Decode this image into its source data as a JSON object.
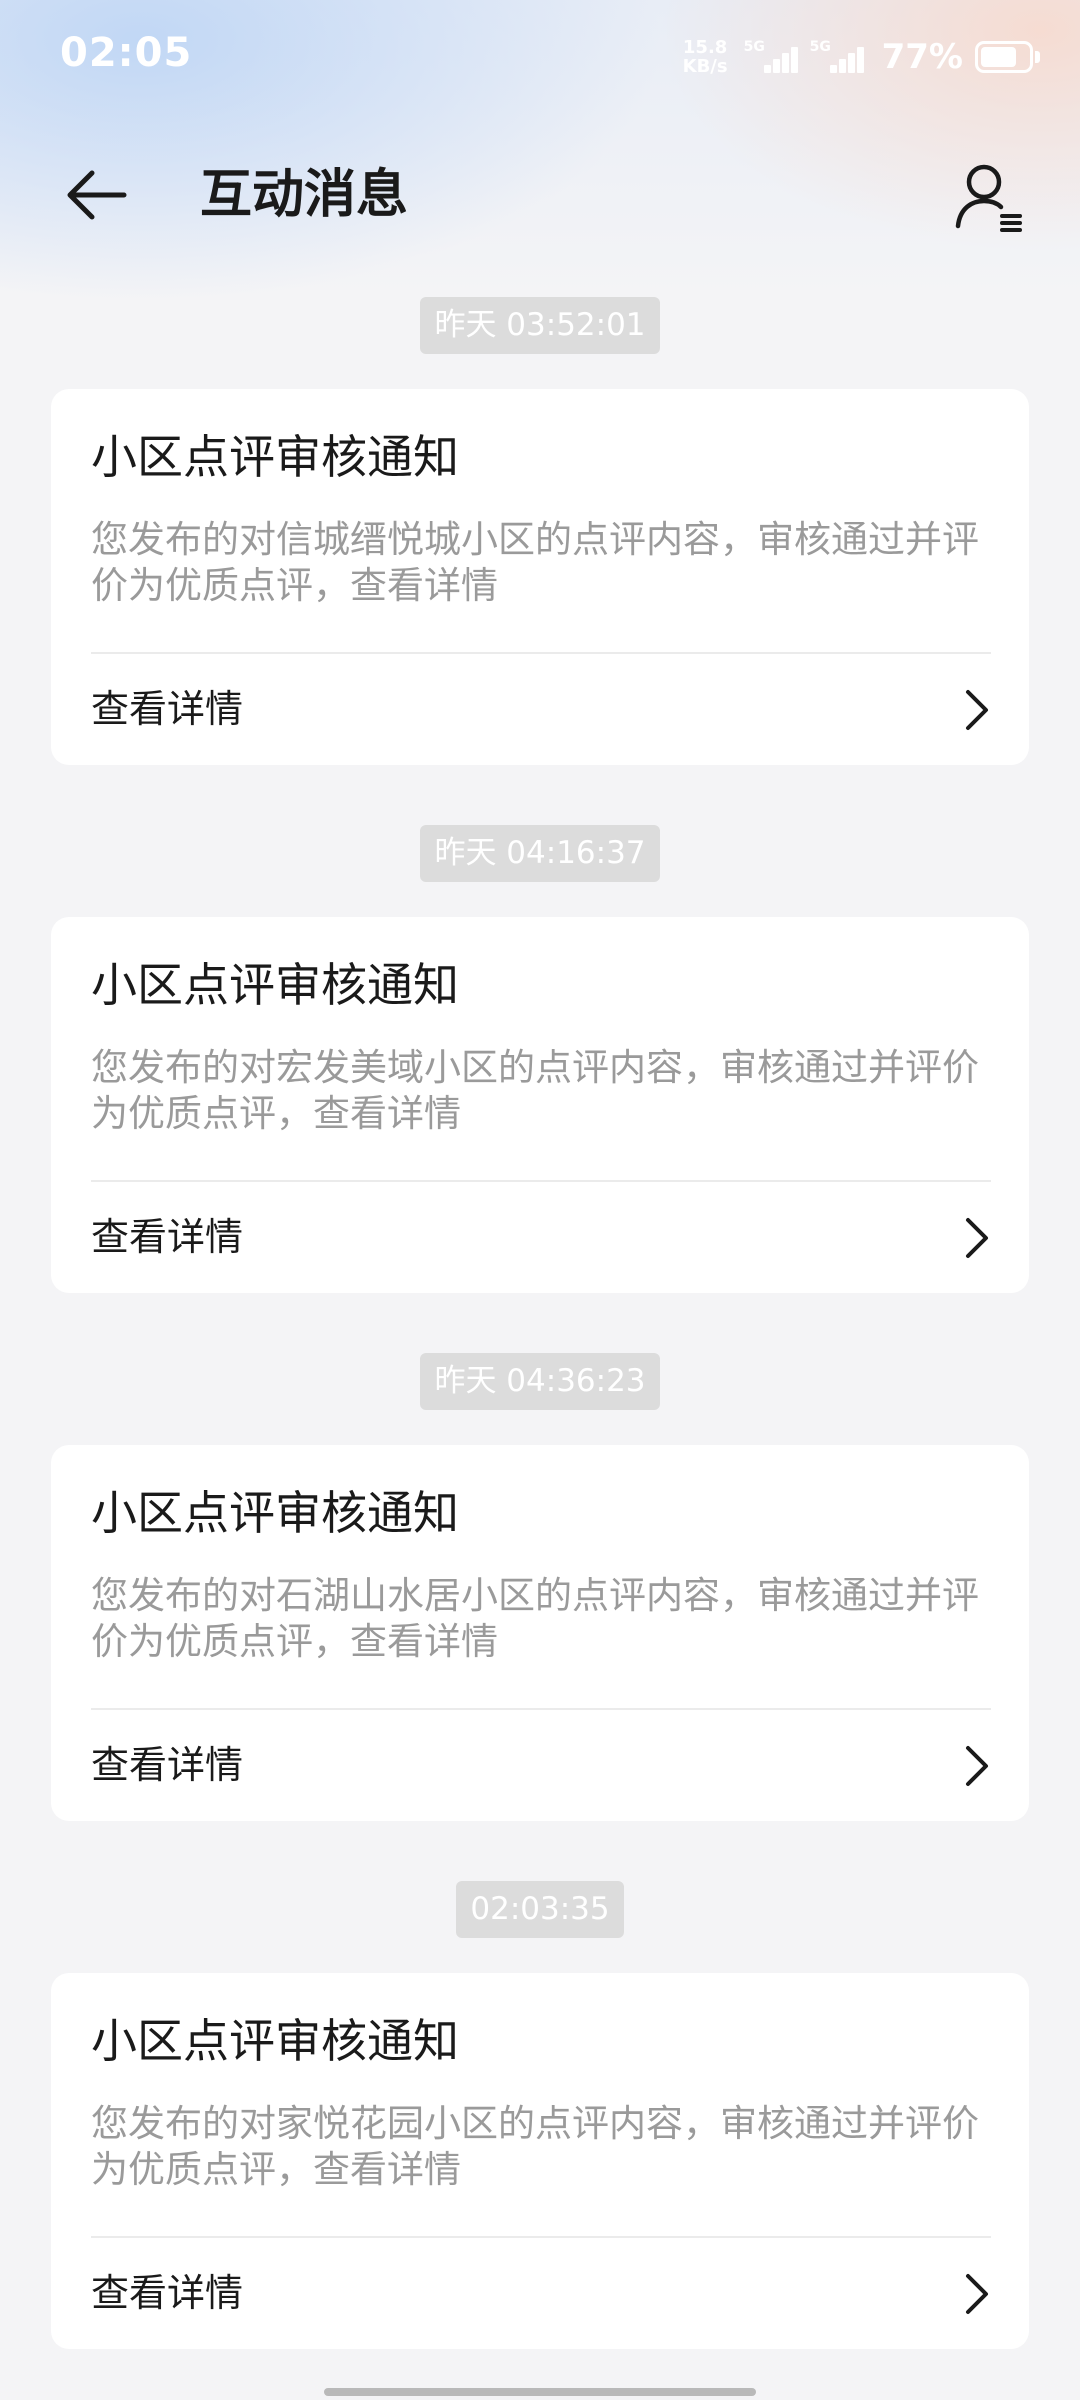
{
  "status_bar": {
    "time": "02:05",
    "net_speed_value": "15.8",
    "net_speed_unit": "KB/s",
    "sim1_label": "5G",
    "sim2_label": "5G",
    "battery_percent_text": "77%",
    "battery_level": 0.77,
    "icons": [
      "signal-bars-icon",
      "signal-bars-icon",
      "battery-icon"
    ]
  },
  "header": {
    "title": "互动消息",
    "back_icon": "arrow-left-icon",
    "profile_icon": "user-settings-icon"
  },
  "messages": [
    {
      "time": "昨天 03:52:01",
      "title": "小区点评审核通知",
      "body": "您发布的对信城缙悦城小区的点评内容，审核通过并评价为优质点评，查看详情",
      "action_label": "查看详情"
    },
    {
      "time": "昨天 04:16:37",
      "title": "小区点评审核通知",
      "body": "您发布的对宏发美域小区的点评内容，审核通过并评价为优质点评，查看详情",
      "action_label": "查看详情"
    },
    {
      "time": "昨天 04:36:23",
      "title": "小区点评审核通知",
      "body": "您发布的对石湖山水居小区的点评内容，审核通过并评价为优质点评，查看详情",
      "action_label": "查看详情"
    },
    {
      "time": "02:03:35",
      "title": "小区点评审核通知",
      "body": "您发布的对家悦花园小区的点评内容，审核通过并评价为优质点评，查看详情",
      "action_label": "查看详情"
    }
  ],
  "colors": {
    "background": "#f4f4f6",
    "card": "#ffffff",
    "title_text": "#1a1a1a",
    "body_text": "#9a9a9a",
    "time_chip_bg": "#dcdcdc"
  }
}
